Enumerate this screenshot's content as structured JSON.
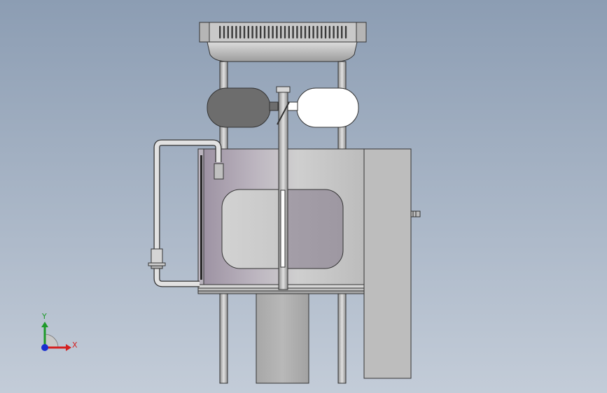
{
  "viewport": {
    "background_top": "#8c9db3",
    "background_bottom": "#c3ccd8"
  },
  "triad": {
    "x_label": "X",
    "y_label": "Y",
    "x_color": "#d42020",
    "y_color": "#1e9a2a",
    "z_color": "#1a2fd0"
  },
  "model": {
    "body_color": "#c6c6c6",
    "shadow_color": "#8f8f8f",
    "outline_color": "#2a2a2a",
    "dark_fill": "#6d6d6d",
    "light_fill": "#ffffff"
  }
}
